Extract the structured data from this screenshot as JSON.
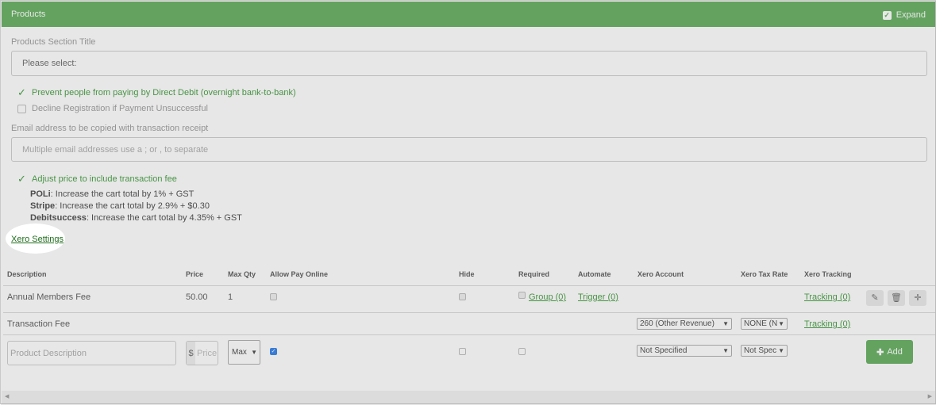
{
  "header": {
    "title": "Products",
    "expand_label": "Expand"
  },
  "section_title": {
    "label": "Products Section Title",
    "value": "Please select:"
  },
  "options": {
    "prevent_dd": "Prevent people from paying by Direct Debit (overnight bank-to-bank)",
    "decline_reg": "Decline Registration if Payment Unsuccessful"
  },
  "email": {
    "label": "Email address to be copied with transaction receipt",
    "placeholder": "Multiple email addresses use a ; or , to separate"
  },
  "fee": {
    "adjust_label": "Adjust price to include transaction fee",
    "lines": [
      {
        "name": "POLi",
        "text": ": Increase the cart total by 1% + GST"
      },
      {
        "name": "Stripe",
        "text": ": Increase the cart total by 2.9% + $0.30"
      },
      {
        "name": "Debitsuccess",
        "text": ": Increase the cart total by 4.35% + GST"
      }
    ]
  },
  "xero_settings_link": "Xero Settings",
  "table": {
    "headers": [
      "Description",
      "Price",
      "Max Qty",
      "Allow Pay Online",
      "Hide",
      "Required",
      "Automate",
      "Xero Account",
      "Xero Tax Rate",
      "Xero Tracking"
    ],
    "rows": [
      {
        "description": "Annual Members Fee",
        "price": "50.00",
        "max_qty": "1",
        "required": "Group (0)",
        "automate": "Trigger (0)",
        "tracking": "Tracking (0)"
      },
      {
        "description": "Transaction Fee",
        "xero_account": "260 (Other Revenue)",
        "xero_tax": "NONE (N",
        "tracking": "Tracking (0)"
      }
    ],
    "new_row": {
      "description_placeholder": "Product Description",
      "currency": "$",
      "price_placeholder": "Price",
      "max_qty": "Max",
      "xero_account": "Not Specified",
      "xero_tax": "Not Spec",
      "add_label": "Add"
    }
  },
  "colors": {
    "accent": "#5fad5a",
    "link": "#3e9a3a"
  }
}
